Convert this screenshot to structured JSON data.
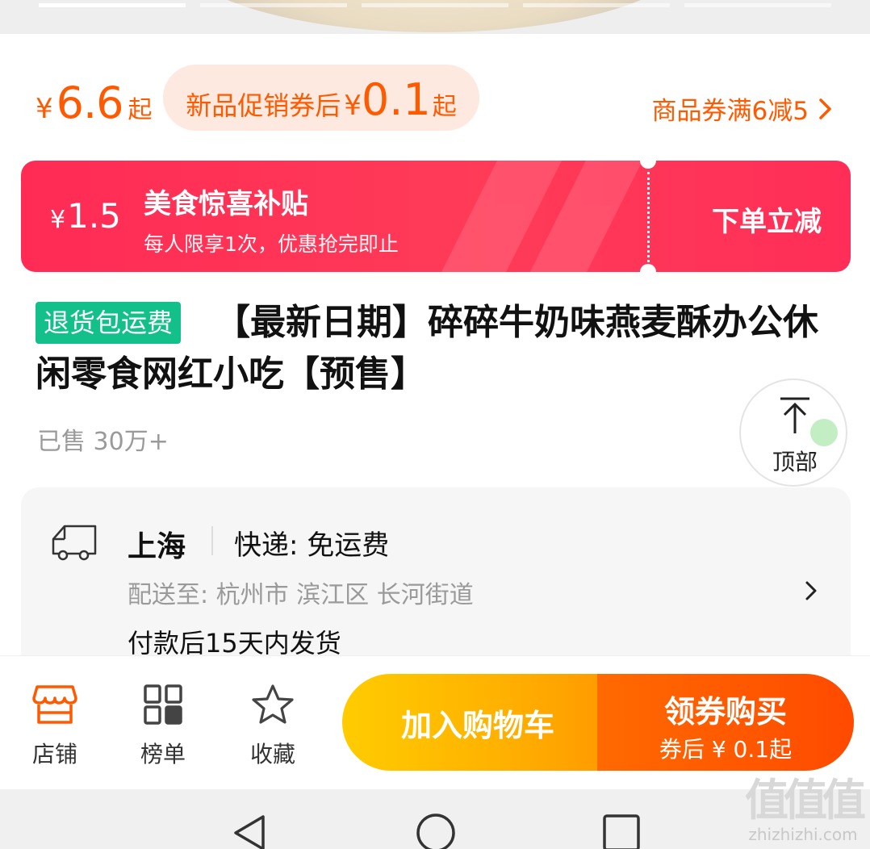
{
  "price": {
    "currency": "¥",
    "value": "6.6",
    "suffix": "起"
  },
  "promo": {
    "text": "新品促销券后",
    "currency": "¥",
    "value": "0.1",
    "suffix": "起"
  },
  "coupon_link": "商品券满6减5",
  "subsidy": {
    "currency": "¥",
    "amount": "1.5",
    "title": "美食惊喜补贴",
    "desc": "每人限享1次，优惠抢完即止",
    "action": "下单立减"
  },
  "product": {
    "badge": "退货包运费",
    "title": "【最新日期】碎碎牛奶味燕麦酥办公休闲零食网红小吃【预售】",
    "sold": "已售 30万+"
  },
  "back_to_top": "顶部",
  "shipping": {
    "origin": "上海",
    "method": "快递: 免运费",
    "destination": "配送至: 杭州市 滨江区 长河街道",
    "dispatch": "付款后15天内发货"
  },
  "bottom_nav": [
    {
      "label": "店铺",
      "icon": "store-icon"
    },
    {
      "label": "榜单",
      "icon": "ranking-grid-icon"
    },
    {
      "label": "收藏",
      "icon": "star-icon"
    }
  ],
  "actions": {
    "add_cart": "加入购物车",
    "buy_title": "领券购买",
    "buy_sub": "券后 ¥ 0.1起"
  },
  "watermark": {
    "logo": "值值值",
    "url": "zhizhizhi.com"
  },
  "colors": {
    "accent_orange": "#ff5a00",
    "subsidy_red": "#ff2b55",
    "badge_green": "#13c08a",
    "cart_yellow": "#ffb100",
    "buy_orange": "#ff5500"
  }
}
